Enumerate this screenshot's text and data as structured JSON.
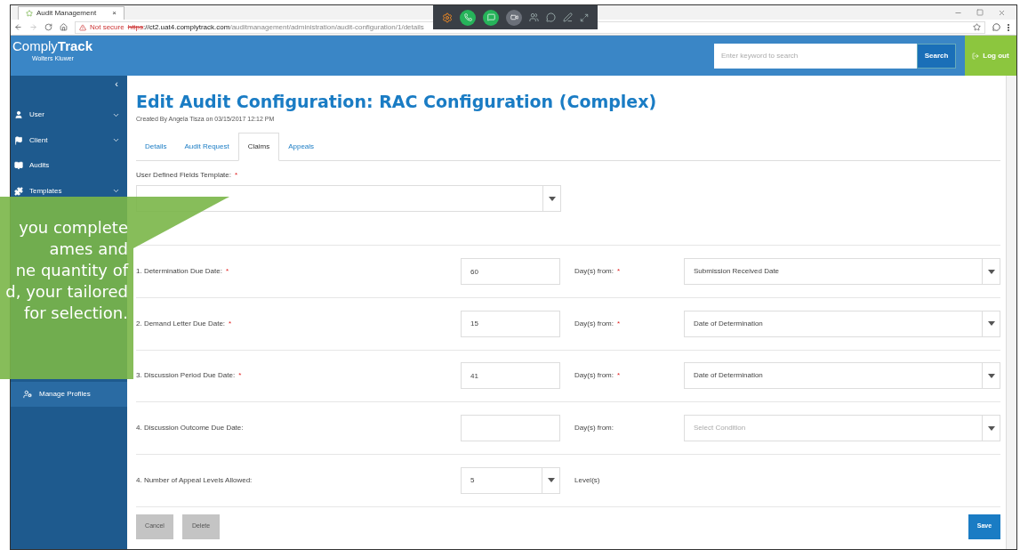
{
  "browser": {
    "tab_title": "Audit Management",
    "tab_close": "×",
    "not_secure": "Not secure",
    "url_scheme": "https",
    "url_rest": "://ct2.uat4.complytrack.com",
    "url_path": "/auditmanagement/administration/audit-configuration/1/details"
  },
  "app": {
    "logo_light": "Comply",
    "logo_bold": "Track",
    "logo_sub": "Wolters Kluwer",
    "search_placeholder": "Enter keyword to search",
    "search_button": "Search",
    "logout": "Log out"
  },
  "sidebar": {
    "collapse": "‹",
    "items": [
      {
        "label": "User",
        "kind": "group",
        "expanded": false
      },
      {
        "label": "Client",
        "kind": "group",
        "expanded": false
      },
      {
        "label": "Audits",
        "kind": "link"
      },
      {
        "label": "Templates",
        "kind": "group",
        "expanded": false
      }
    ],
    "sub_items": [
      {
        "label": "Manage Profiles",
        "selected": true
      }
    ]
  },
  "page": {
    "title": "Edit Audit Configuration: RAC Configuration (Complex)",
    "subtitle": "Created By Angela Tisza on 03/15/2017 12:12 PM",
    "tabs": [
      {
        "label": "Details",
        "selected": false
      },
      {
        "label": "Audit Request",
        "selected": false
      },
      {
        "label": "Claims",
        "selected": true
      },
      {
        "label": "Appeals",
        "selected": false
      }
    ],
    "required_mark": "*",
    "udf": {
      "label": "User Defined Fields Template:",
      "required": true
    },
    "rules": [
      {
        "kind": "due",
        "label": "1. Determination Due Date:",
        "required": true,
        "value": "60",
        "from_label": "Day(s) from:",
        "from_required": true,
        "condition": "Submission Received Date"
      },
      {
        "kind": "due",
        "label": "2. Demand Letter Due Date:",
        "required": true,
        "value": "15",
        "from_label": "Day(s) from:",
        "from_required": true,
        "condition": "Date of Determination"
      },
      {
        "kind": "due",
        "label": "3. Discussion Period Due Date:",
        "required": true,
        "value": "41",
        "from_label": "Day(s) from:",
        "from_required": true,
        "condition": "Date of Determination"
      },
      {
        "kind": "due",
        "label": "4. Discussion Outcome Due Date:",
        "required": false,
        "from_label": "Day(s) from:",
        "from_required": false,
        "condition_placeholder": "Select Condition"
      },
      {
        "kind": "levels",
        "label": "4. Number of Appeal Levels Allowed:",
        "required": false,
        "value": "5",
        "unit": "Level(s)"
      }
    ],
    "buttons": {
      "cancel": "Cancel",
      "delete": "Delete",
      "save": "Save"
    }
  },
  "callout": {
    "lines": [
      "you complete",
      "ames and",
      "ne quantity of",
      "d, your tailored",
      "for selection."
    ]
  }
}
